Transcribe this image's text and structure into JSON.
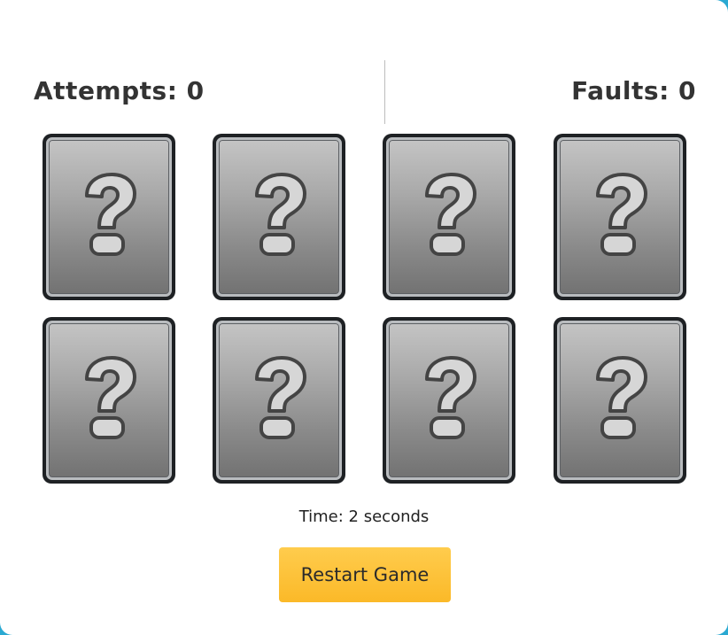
{
  "scoreboard": {
    "attempts_label": "Attempts: 0",
    "faults_label": "Faults: 0"
  },
  "cards": [
    {
      "face": "?",
      "state": "hidden"
    },
    {
      "face": "?",
      "state": "hidden"
    },
    {
      "face": "?",
      "state": "hidden"
    },
    {
      "face": "?",
      "state": "hidden"
    },
    {
      "face": "?",
      "state": "hidden"
    },
    {
      "face": "?",
      "state": "hidden"
    },
    {
      "face": "?",
      "state": "hidden"
    },
    {
      "face": "?",
      "state": "hidden"
    }
  ],
  "timer": {
    "text": "Time: 2 seconds"
  },
  "controls": {
    "restart_label": "Restart Game"
  },
  "colors": {
    "background": "#2aa9d2",
    "panel": "#ffffff",
    "button": "#fbb928",
    "card_frame": "#1e2124",
    "card_face": "#9a9a9a"
  },
  "icons": {
    "card_back": "question-mark-icon"
  }
}
